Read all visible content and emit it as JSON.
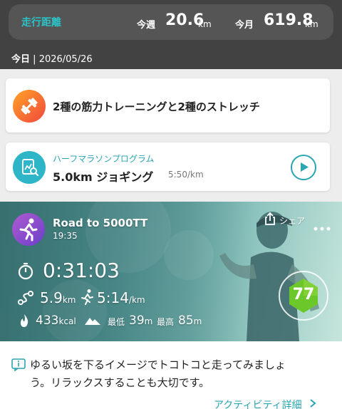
{
  "summary": {
    "label": "走行距離",
    "week_label": "今週",
    "week_value": "20.6",
    "week_unit": "km",
    "month_label": "今月",
    "month_value": "619.8",
    "month_unit": "km"
  },
  "today": {
    "label": "今日",
    "sep": "|",
    "date": "2026/05/26"
  },
  "workout_card": {
    "title": "2種の筋力トレーニングと2種のストレッチ",
    "icon": "dumbbell-icon"
  },
  "program_card": {
    "subtitle": "ハーフマラソンプログラム",
    "title": "5.0km ジョギング",
    "pace": "5:50/km",
    "icon": "report-search-icon",
    "play_icon": "play-icon"
  },
  "activity": {
    "name": "Road to 5000TT",
    "time": "19:35",
    "share_label": "シェア",
    "duration": "0:31:03",
    "distance": "5.9",
    "distance_unit": "km",
    "pace": "5:14",
    "pace_unit": "/km",
    "calories": "433",
    "calories_unit": "kcal",
    "elev_min_label": "最低",
    "elev_min": "39",
    "elev_min_unit": "m",
    "elev_max_label": "最高",
    "elev_max": "85",
    "elev_max_unit": "m",
    "score": "77",
    "score_color": "#6cc72a"
  },
  "message": {
    "line1": "ゆるい坂を下るイメージでトコトコと走ってみましょ",
    "line2": "う。リラックスすることも大切です。"
  },
  "detail_link": "アクティビティ詳細",
  "colors": {
    "accent": "#2aa5b3",
    "header_bg": "#424242"
  }
}
